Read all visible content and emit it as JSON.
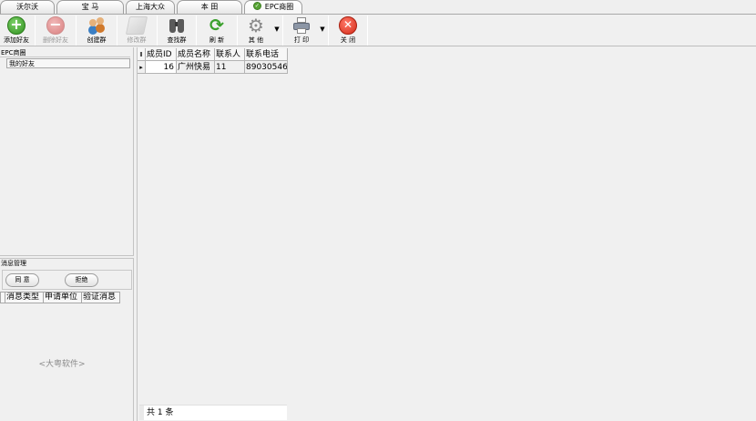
{
  "tabs": [
    {
      "label": "沃尔沃",
      "active": false
    },
    {
      "label": "宝 马",
      "active": false
    },
    {
      "label": "上海大众",
      "active": false
    },
    {
      "label": "本 田",
      "active": false
    },
    {
      "label": "EPC商圈",
      "active": true,
      "icon": "check-circle-icon"
    }
  ],
  "toolbar": {
    "add_friend": "添加好友",
    "delete_friend": "删除好友",
    "create_group": "创建群",
    "edit_group": "修改群",
    "find_group": "查找群",
    "refresh": "刷 新",
    "other": "其 他",
    "print": "打 印",
    "close": "关 闭",
    "dropdown_arrow": "▼"
  },
  "tree": {
    "root": "EPC商圈",
    "child": "我的好友"
  },
  "messages": {
    "title": "消息管理",
    "agree": "同 意",
    "reject": "拒绝",
    "columns": [
      "消息类型",
      "申请单位",
      "验证消息"
    ],
    "watermark": "<大粤软件>"
  },
  "grid": {
    "columns": [
      "成员ID",
      "成员名称",
      "联系人",
      "联系电话"
    ],
    "rows": [
      {
        "id": "16",
        "name": "广州快易",
        "contact": "11",
        "phone": "89030546"
      }
    ],
    "footer": "共 1 条"
  },
  "colors": {
    "accent_green": "#3aa02c",
    "close_red": "#d42a17"
  }
}
